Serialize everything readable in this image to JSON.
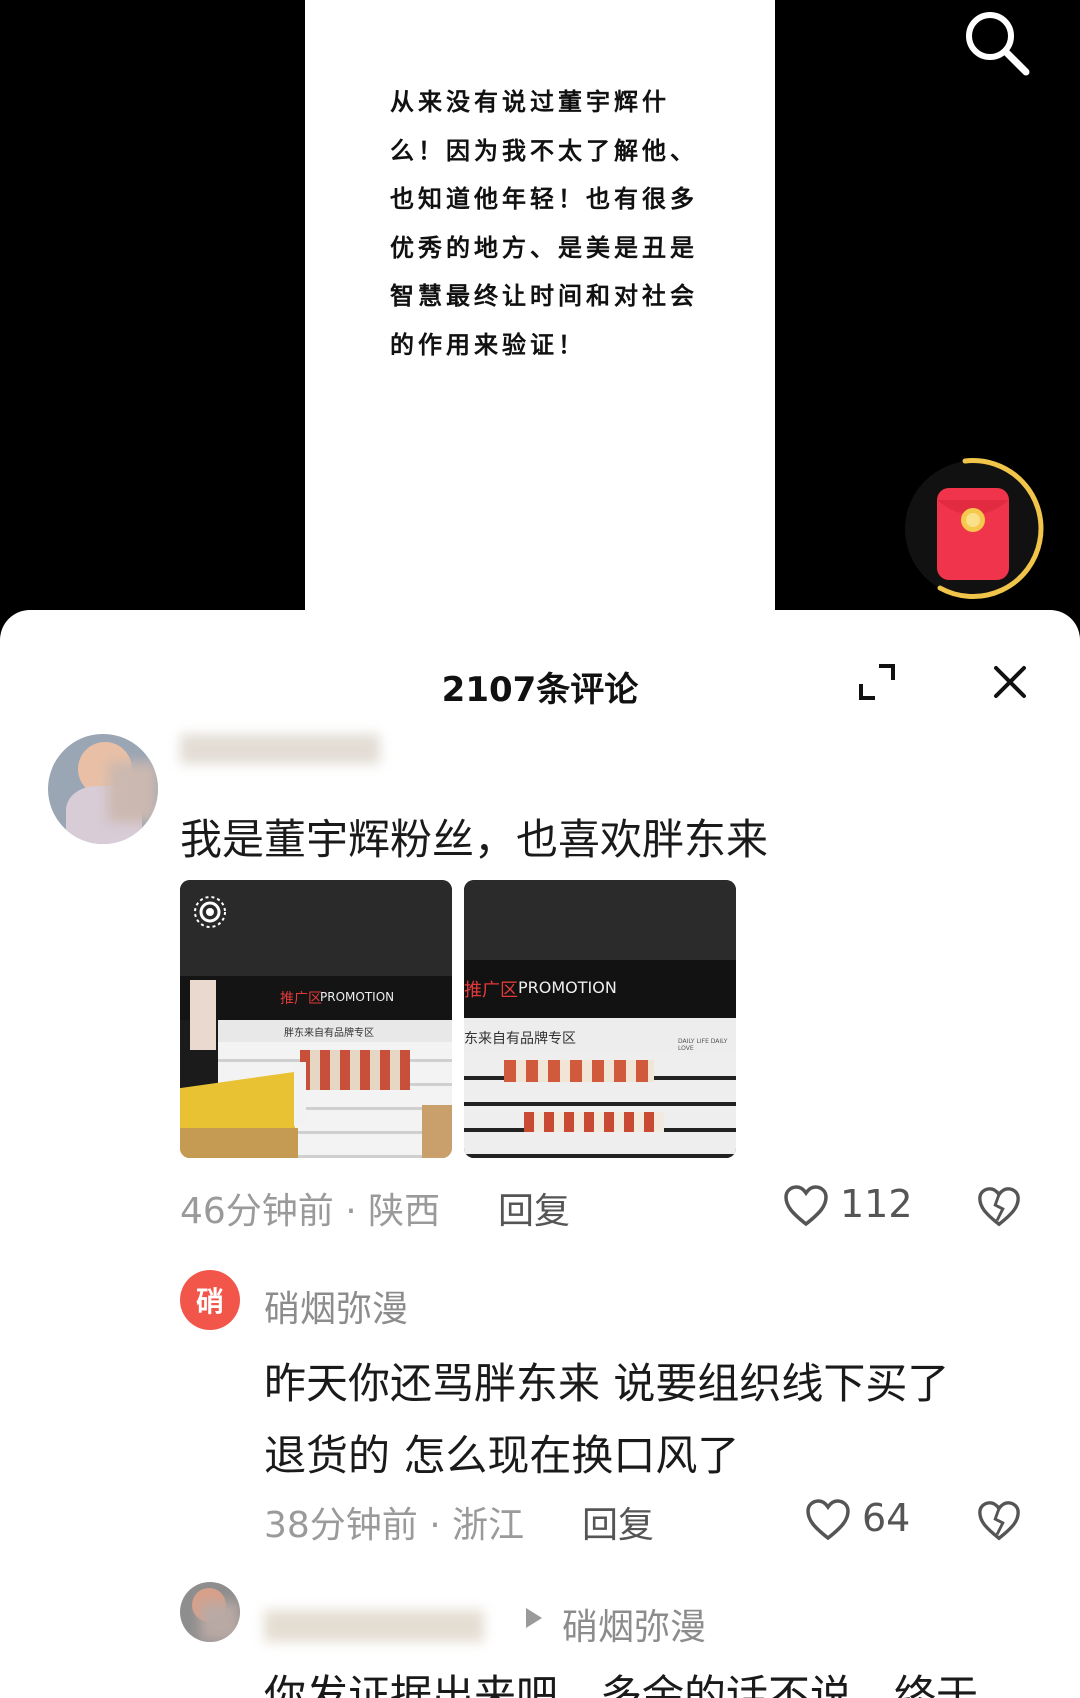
{
  "video": {
    "card_text": "从来没有说过董宇辉什\n么！因为我不太了解他、\n也知道他年轻！也有很多\n优秀的地方、是美是丑是\n智慧最终让时间和对社会\n的作用来验证！"
  },
  "icons": {
    "search": "search-icon",
    "red_packet": "red-packet-icon",
    "expand": "expand-icon",
    "close": "close-icon",
    "heart": "heart-icon",
    "dislike": "broken-heart-icon",
    "reply_arrow": "play-triangle-icon",
    "live_badge": "live-ring-icon"
  },
  "comments_panel": {
    "title": "2107条评论",
    "comments": [
      {
        "text": "我是董宇辉粉丝，也喜欢胖东来",
        "meta": "46分钟前 · 陕西",
        "reply_label": "回复",
        "likes": "112",
        "photos": [
          {
            "sign_main": "推广区",
            "sign_sub": "PROMOTION",
            "shelf_label": "胖东来自有品牌专区"
          },
          {
            "sign_main": "推广区",
            "sign_sub": "PROMOTION",
            "shelf_label": "东来自有品牌专区",
            "shelf_tag": "DAILY LIFE DAILY LOVE"
          }
        ]
      },
      {
        "badge": "硝",
        "username": "硝烟弥漫",
        "text_line1": "昨天你还骂胖东来 说要组织线下买了",
        "text_line2": "退货的 怎么现在换口风了",
        "meta": "38分钟前 · 浙江",
        "reply_label": "回复",
        "likes": "64"
      },
      {
        "reply_to": "硝烟弥漫",
        "text": "你发证据出来吧，多余的话不说，终于"
      }
    ]
  },
  "colors": {
    "accent_red": "#f2564b",
    "red_packet": "#f0344c",
    "ring_gold": "#f1c44a"
  }
}
